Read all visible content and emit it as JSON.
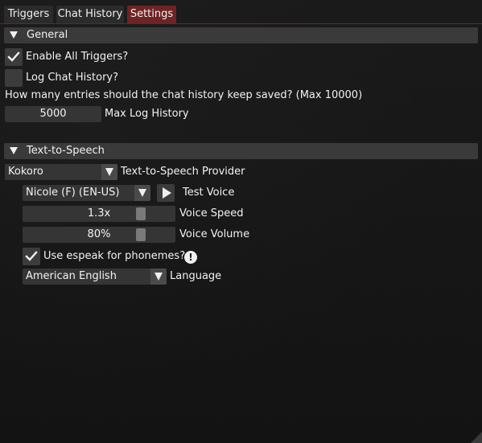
{
  "tabs": [
    {
      "label": "Triggers",
      "active": false
    },
    {
      "label": "Chat History",
      "active": false
    },
    {
      "label": "Settings",
      "active": true
    }
  ],
  "general": {
    "header": "General",
    "enable_triggers": {
      "label": "Enable All Triggers?",
      "checked": true
    },
    "log_chat": {
      "label": "Log Chat History?",
      "checked": false
    },
    "history_question": "How many entries should the chat history keep saved? (Max 10000)",
    "max_log": {
      "value": "5000",
      "label": "Max Log History"
    }
  },
  "tts": {
    "header": "Text-to-Speech",
    "provider": {
      "value": "Kokoro",
      "label": "Text-to-Speech Provider"
    },
    "voice": {
      "value": "Nicole (F) (EN-US)",
      "test_label": "Test Voice"
    },
    "speed": {
      "value": "1.3x",
      "label": "Voice Speed"
    },
    "volume": {
      "value": "80%",
      "label": "Voice Volume"
    },
    "espeak": {
      "label": "Use espeak for phonemes?",
      "checked": true,
      "info_glyph": "!"
    },
    "language": {
      "value": "American English",
      "label": "Language"
    }
  },
  "colors": {
    "active_tab": "#6e2424",
    "section_header": "#3a3a3a",
    "frame": "#353535"
  }
}
